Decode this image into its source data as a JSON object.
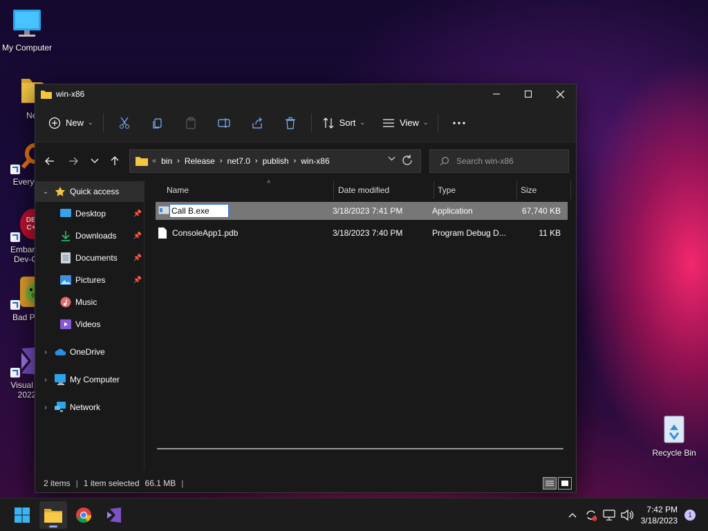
{
  "desktop": {
    "icons": [
      {
        "label": "My Computer"
      },
      {
        "label": "New fol"
      },
      {
        "label": "Everyth"
      },
      {
        "label": "Embarca",
        "label2": "Dev-C-"
      },
      {
        "label": "Bad Pig"
      },
      {
        "label": "Visual St",
        "label2": "2022"
      },
      {
        "label": "Recycle Bin"
      }
    ],
    "devcpp_badge": "DEV C++"
  },
  "window": {
    "title": "win-x86",
    "toolbar": {
      "new_label": "New",
      "sort_label": "Sort",
      "view_label": "View"
    },
    "address": {
      "overflow": "«",
      "crumbs": [
        "bin",
        "Release",
        "net7.0",
        "publish",
        "win-x86"
      ]
    },
    "search": {
      "placeholder": "Search win-x86"
    },
    "nav": {
      "quick_access": "Quick access",
      "desktop": "Desktop",
      "downloads": "Downloads",
      "documents": "Documents",
      "pictures": "Pictures",
      "music": "Music",
      "videos": "Videos",
      "onedrive": "OneDrive",
      "my_computer": "My Computer",
      "network": "Network"
    },
    "columns": {
      "name": "Name",
      "date": "Date modified",
      "type": "Type",
      "size": "Size"
    },
    "files": [
      {
        "name": "Call B.exe",
        "rename_value": "Call B.exe",
        "date": "3/18/2023 7:41 PM",
        "type": "Application",
        "size": "67,740 KB"
      },
      {
        "name": "ConsoleApp1.pdb",
        "date": "3/18/2023 7:40 PM",
        "type": "Program Debug D...",
        "size": "11 KB"
      }
    ],
    "status": {
      "items": "2 items",
      "selected": "1 item selected",
      "size": "66.1 MB",
      "sep": "|"
    }
  },
  "taskbar": {
    "time": "7:42 PM",
    "date": "3/18/2023",
    "notification_count": "1"
  },
  "colors": {
    "accent": "#2a6ee0",
    "folder": "#f5c542",
    "selected_row": "#777777"
  }
}
